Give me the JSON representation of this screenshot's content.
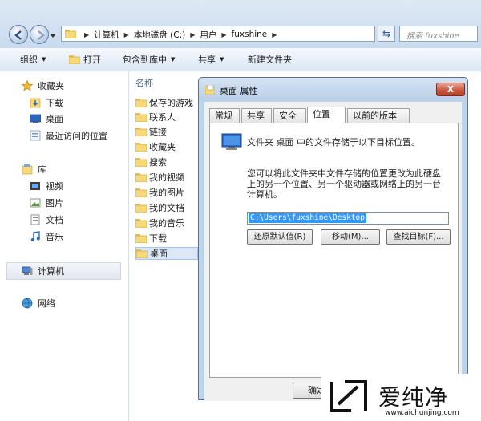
{
  "address_bar": {
    "breadcrumbs": [
      "计算机",
      "本地磁盘 (C:)",
      "用户",
      "fuxshine"
    ],
    "search_placeholder": "搜索 fuxshine"
  },
  "toolbar": {
    "organize": "组织",
    "open": "打开",
    "include_in_library": "包含到库中",
    "share": "共享",
    "new_folder": "新建文件夹"
  },
  "nav_pane": {
    "favorites": "收藏夹",
    "downloads": "下载",
    "desktop": "桌面",
    "recent": "最近访问的位置",
    "libraries": "库",
    "videos": "视频",
    "pictures": "图片",
    "documents": "文档",
    "music": "音乐",
    "computer": "计算机",
    "network": "网络"
  },
  "file_list": {
    "column_name": "名称",
    "items": [
      "保存的游戏",
      "联系人",
      "链接",
      "收藏夹",
      "搜索",
      "我的视频",
      "我的图片",
      "我的文档",
      "我的音乐",
      "下载",
      "桌面"
    ],
    "selected_index": 10
  },
  "dialog": {
    "title": "桌面 属性",
    "close_label": "X",
    "tabs": [
      "常规",
      "共享",
      "安全",
      "位置",
      "以前的版本"
    ],
    "active_tab": "位置",
    "description": "文件夹 桌面 中的文件存储于以下目标位置。",
    "paragraph": "您可以将此文件夹中文件存储的位置更改为此硬盘上的另一个位置、另一个驱动器或网络上的另一台计算机。",
    "path_value": "C:\\Users\\fuxshine\\Desktop",
    "restore_default": "还原默认值(R)",
    "move": "移动(M)...",
    "find_target": "查找目标(F)...",
    "ok": "确定"
  },
  "watermark": {
    "brand": "爱纯净",
    "url": "www.aichunjing.com"
  }
}
